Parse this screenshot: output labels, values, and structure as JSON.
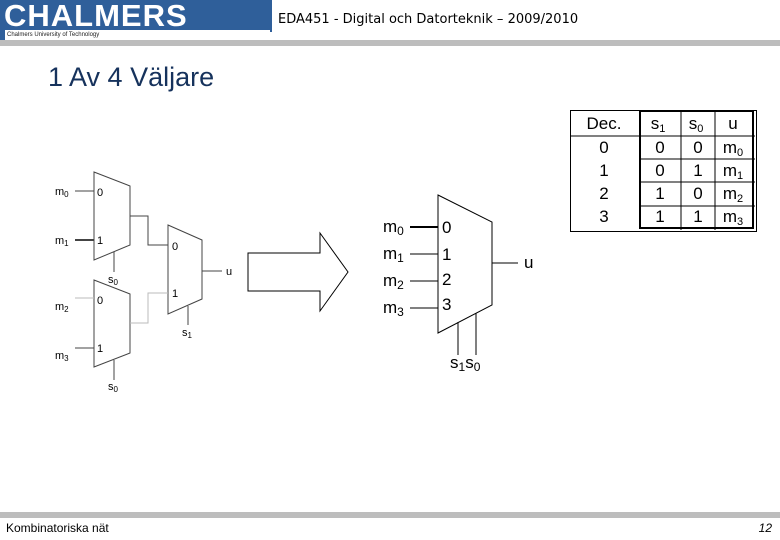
{
  "header": {
    "logo_text": "CHALMERS",
    "logo_subtitle": "Chalmers University of Technology",
    "course_title": "EDA451 - Digital och Datorteknik – 2009/2010",
    "brand_color": "#2f5f9a"
  },
  "slide": {
    "title": "1 Av 4 Väljare",
    "title_color": "#16325c"
  },
  "left_circuit": {
    "inputs": [
      "m0",
      "m1",
      "m2",
      "m3"
    ],
    "mux_top": {
      "in0": "0",
      "in1": "1",
      "select": "s0"
    },
    "mux_bottom": {
      "in0": "0",
      "in1": "1",
      "select": "s0"
    },
    "mux_final": {
      "in0": "0",
      "in1": "1",
      "select": "s1",
      "output": "u"
    }
  },
  "arrow": {
    "icon": "right-arrow-icon"
  },
  "right_circuit": {
    "inputs": [
      {
        "label": "m",
        "sub": "0",
        "port": "0"
      },
      {
        "label": "m",
        "sub": "1",
        "port": "1"
      },
      {
        "label": "m",
        "sub": "2",
        "port": "2"
      },
      {
        "label": "m",
        "sub": "3",
        "port": "3"
      }
    ],
    "select_labels": [
      {
        "label": "s",
        "sub": "1"
      },
      {
        "label": "s",
        "sub": "0"
      }
    ],
    "output": "u"
  },
  "truth_table": {
    "headers": [
      {
        "text": "Dec.",
        "sub": ""
      },
      {
        "text": "s",
        "sub": "1"
      },
      {
        "text": "s",
        "sub": "0"
      },
      {
        "text": "u",
        "sub": ""
      }
    ],
    "rows": [
      {
        "dec": "0",
        "s1": "0",
        "s0": "0",
        "u": "m",
        "u_sub": "0"
      },
      {
        "dec": "1",
        "s1": "0",
        "s0": "1",
        "u": "m",
        "u_sub": "1"
      },
      {
        "dec": "2",
        "s1": "1",
        "s0": "0",
        "u": "m",
        "u_sub": "2"
      },
      {
        "dec": "3",
        "s1": "1",
        "s0": "1",
        "u": "m",
        "u_sub": "3"
      }
    ]
  },
  "footer": {
    "left": "Kombinatoriska nät",
    "page_number": "12"
  }
}
